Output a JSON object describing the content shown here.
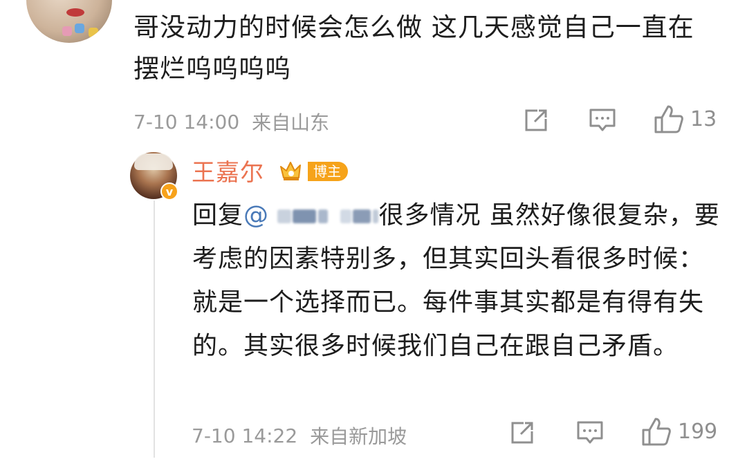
{
  "comment": {
    "text": "哥没动力的时候会怎么做 这几天感觉自己一直在摆烂呜呜呜呜",
    "time": "7-10 14:00",
    "source": "来自山东",
    "likes": "13"
  },
  "reply": {
    "username": "王嘉尔",
    "badge_label": "博主",
    "verified_mark": "v",
    "reply_prefix": "回复",
    "mention_at": "@",
    "text": "很多情况 虽然好像很复杂，要考虑的因素特别多，但其实回头看很多时候：就是一个选择而已。每件事其实都是有得有失的。其实很多时候我们自己在跟自己矛盾。",
    "time": "7-10 14:22",
    "source": "来自新加坡",
    "likes": "199"
  },
  "icons": [
    "share-icon",
    "comment-icon",
    "like-icon",
    "crown-icon",
    "verified-icon"
  ],
  "colors": {
    "username": "#eb7350",
    "badge": "#f6a31a",
    "mention": "#4a7ab8",
    "meta": "#9a9a9a"
  }
}
